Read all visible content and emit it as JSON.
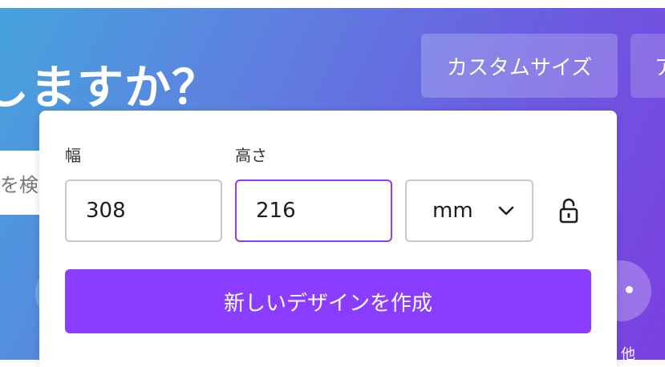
{
  "hero": {
    "title_fragment": "しますか？",
    "custom_size_label": "カスタムサイズ",
    "next_pill_fragment": "ア",
    "search_fragment": "を検索",
    "bottom_fragment": "他"
  },
  "dialog": {
    "width_label": "幅",
    "height_label": "高さ",
    "width_value": "308",
    "height_value": "216",
    "unit_value": "mm",
    "lock_icon": "lock-open-icon",
    "create_button_label": "新しいデザインを作成"
  },
  "colors": {
    "accent": "#8b3dff",
    "gradient_start": "#45a3dc",
    "gradient_end": "#7b3fe0"
  }
}
